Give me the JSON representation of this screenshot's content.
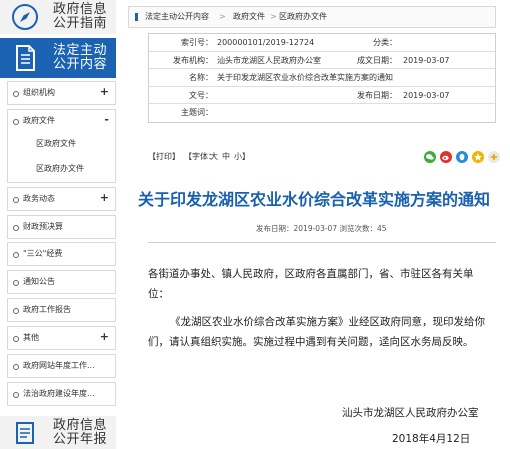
{
  "sidebar": {
    "top_header": {
      "line1": "政府信息",
      "line2": "公开指南"
    },
    "active_header": {
      "line1": "法定主动",
      "line2": "公开内容"
    },
    "bottom_header": {
      "line1": "政府信息",
      "line2": "公开年报"
    },
    "menu": {
      "org": {
        "label": "组织机构",
        "toggle": "+"
      },
      "docs": {
        "label": "政府文件",
        "toggle": "-"
      },
      "docs_sub": [
        "区政府文件",
        "区政府办文件"
      ],
      "affairs": {
        "label": "政务动态",
        "toggle": "+"
      },
      "budget": {
        "label": "财政预决算"
      },
      "sangong": {
        "label": "\"三公\"经费"
      },
      "notice": {
        "label": "通知公告"
      },
      "report": {
        "label": "政府工作报告"
      },
      "other": {
        "label": "其他",
        "toggle": "+"
      },
      "web_annual": {
        "label": "政府网站年度工作..."
      },
      "law_annual": {
        "label": "法治政府建设年度..."
      }
    }
  },
  "breadcrumb": {
    "items": [
      "法定主动公开内容",
      "政府文件",
      "区政府办文件"
    ],
    "separator": ">"
  },
  "meta": {
    "index_label": "索引号：",
    "index_value": "200000101/2019-12724",
    "category_label": "分类：",
    "category_value": "",
    "publisher_label": "发布机构：",
    "publisher_value": "汕头市龙湖区人民政府办公室",
    "date_label": "成文日期：",
    "date_value": "2019-03-07",
    "name_label": "名称：",
    "name_value": "关于印发龙湖区农业水价综合改革实施方案的通知",
    "docno_label": "文号：",
    "docno_value": "",
    "pubdate_label": "发布日期：",
    "pubdate_value": "2019-03-07",
    "topic_label": "主题词：",
    "topic_value": ""
  },
  "toolbar": {
    "print": "【打印】",
    "font_prefix": "【字体：",
    "font_large": "大",
    "font_medium": "中",
    "font_small": "小",
    "font_suffix": "】",
    "share_icons": [
      "wechat-icon",
      "weibo-icon",
      "qq-icon",
      "qzone-icon",
      "share-icon"
    ]
  },
  "document": {
    "title": "关于印发龙湖区农业水价综合改革实施方案的通知",
    "meta_line": "发布日期：2019-03-07  浏览次数：45",
    "salutation_line1": "各街道办事处、镇人民政府，区政府各直属部门，省、市驻区各有关单",
    "salutation_line2": "位：",
    "para_line1": "《龙湖区农业水价综合改革实施方案》业经区政府同意，现印发给你",
    "para_line2": "们，请认真组织实施。实施过程中遇到有关问题，迳向区水务局反映。",
    "signoff_org": "汕头市龙湖区人民政府办公室",
    "signoff_date": "2018年4月12日"
  },
  "colors": {
    "accent": "#1b62b3",
    "title_blue": "#1860b1",
    "border": "#d9d9d9"
  }
}
